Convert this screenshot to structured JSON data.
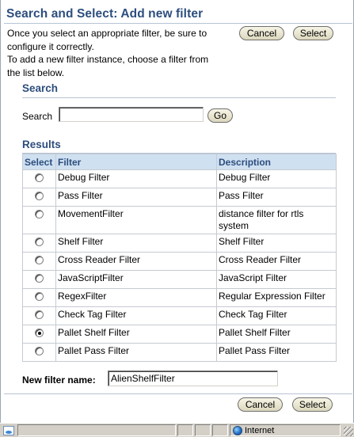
{
  "dialog": {
    "title": "Search and Select: Add new filter",
    "intro_line1": "Once you select an appropriate filter, be sure to",
    "intro_line2": "configure it correctly.",
    "intro_line3": "To add a new filter instance, choose a filter from",
    "intro_line4": "the list below."
  },
  "buttons": {
    "cancel": "Cancel",
    "select": "Select",
    "go": "Go"
  },
  "search": {
    "section_title": "Search",
    "label": "Search",
    "value": ""
  },
  "results": {
    "section_title": "Results",
    "columns": [
      "Select",
      "Filter",
      "Description"
    ],
    "rows": [
      {
        "filter": "Debug Filter",
        "description": "Debug Filter",
        "selected": false
      },
      {
        "filter": "Pass Filter",
        "description": "Pass Filter",
        "selected": false
      },
      {
        "filter": "MovementFilter",
        "description": "distance filter for rtls system",
        "selected": false
      },
      {
        "filter": "Shelf Filter",
        "description": "Shelf Filter",
        "selected": false
      },
      {
        "filter": "Cross Reader Filter",
        "description": "Cross Reader Filter",
        "selected": false
      },
      {
        "filter": "JavaScriptFilter",
        "description": "JavaScript Filter",
        "selected": false
      },
      {
        "filter": "RegexFilter",
        "description": "Regular Expression Filter",
        "selected": false
      },
      {
        "filter": "Check Tag Filter",
        "description": "Check Tag Filter",
        "selected": false
      },
      {
        "filter": "Pallet Shelf Filter",
        "description": "Pallet Shelf Filter",
        "selected": true
      },
      {
        "filter": "Pallet Pass Filter",
        "description": "Pallet Pass Filter",
        "selected": false
      }
    ]
  },
  "new_filter": {
    "label": "New filter name:",
    "value": "AlienShelfFilter"
  },
  "statusbar": {
    "zone": "Internet"
  },
  "colors": {
    "heading": "#2d4e7e",
    "table_header_bg": "#cfe0f1"
  }
}
